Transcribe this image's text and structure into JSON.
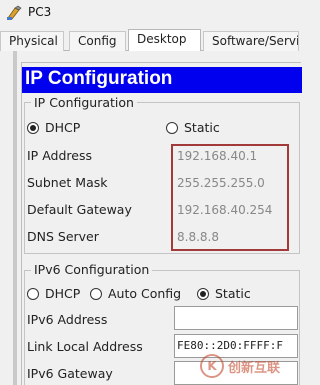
{
  "window": {
    "title": "PC3"
  },
  "tabs": [
    {
      "label": "Physical"
    },
    {
      "label": "Config"
    },
    {
      "label": "Desktop"
    },
    {
      "label": "Software/Servi"
    }
  ],
  "active_tab": "Desktop",
  "header": {
    "title": "IP Configuration"
  },
  "ipv4": {
    "legend": "IP Configuration",
    "mode_options": [
      {
        "label": "DHCP",
        "checked": true
      },
      {
        "label": "Static",
        "checked": false
      }
    ],
    "fields": [
      {
        "label": "IP Address",
        "value": "192.168.40.1"
      },
      {
        "label": "Subnet Mask",
        "value": "255.255.255.0"
      },
      {
        "label": "Default Gateway",
        "value": "192.168.40.254"
      },
      {
        "label": "DNS Server",
        "value": "8.8.8.8"
      }
    ]
  },
  "ipv6": {
    "legend": "IPv6 Configuration",
    "mode_options": [
      {
        "label": "DHCP",
        "checked": false
      },
      {
        "label": "Auto Config",
        "checked": false
      },
      {
        "label": "Static",
        "checked": true
      }
    ],
    "fields": [
      {
        "label": "IPv6 Address",
        "value": ""
      },
      {
        "label": "Link Local Address",
        "value": "FE80::2D0:FFFF:F"
      },
      {
        "label": "IPv6 Gateway",
        "value": ""
      }
    ]
  },
  "watermark": {
    "text": "创新互联"
  },
  "colors": {
    "header_blue": "#0000ee",
    "highlight_border": "#a23a3a"
  }
}
